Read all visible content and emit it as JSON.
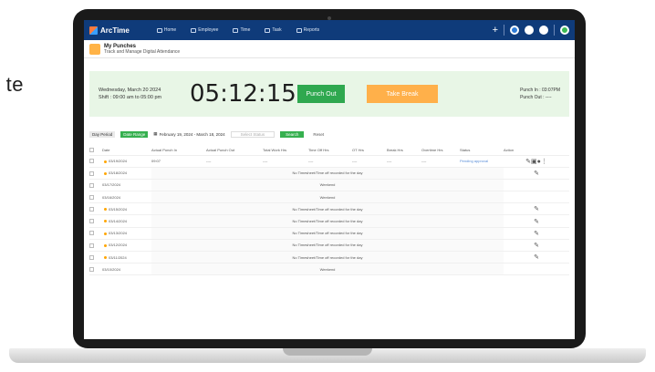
{
  "side_text": "te",
  "app": {
    "name": "ArcTime"
  },
  "nav": [
    "Home",
    "Employee",
    "Time",
    "Task",
    "Reports"
  ],
  "subheader": {
    "title": "My Punches",
    "subtitle": "Track and Manage Digital Attendance"
  },
  "punch": {
    "date": "Wednesday, March 20 2024",
    "shift": "Shift : 09:00 am to 05:00 pm",
    "clock": "05:12:15",
    "punch_out_label": "Punch Out",
    "take_break_label": "Take Break",
    "punch_in_info": "Punch In : 03:07PM",
    "punch_out_info": "Punch Out : ----"
  },
  "filters": {
    "day_period": "Day Period",
    "date_range_tag": "Date Range",
    "date_range": "February 19, 2024 - March 18, 2024",
    "status": "Select Status",
    "search": "Search",
    "reset": "Reset"
  },
  "table": {
    "headers": [
      "Date",
      "Actual Punch In",
      "Actual Punch Out",
      "Total Work Hrs",
      "Time Off Hrs",
      "OT Hrs",
      "Break Hrs",
      "Overtime Hrs",
      "Status",
      "Action"
    ],
    "first_row": {
      "date": "03/19/2024",
      "punch_in": "09:07",
      "dash": "----",
      "status": "Pending approval"
    },
    "rows": [
      {
        "date": "03/18/2024",
        "msg": "No Timesheet/Time off recorded for the day",
        "edit": true
      },
      {
        "date": "03/17/2024",
        "msg": "Weekend",
        "edit": false
      },
      {
        "date": "03/16/2024",
        "msg": "Weekend",
        "edit": false
      },
      {
        "date": "03/15/2024",
        "msg": "No Timesheet/Time off recorded for the day",
        "edit": true
      },
      {
        "date": "03/14/2024",
        "msg": "No Timesheet/Time off recorded for the day",
        "edit": true
      },
      {
        "date": "03/13/2024",
        "msg": "No Timesheet/Time off recorded for the day",
        "edit": true
      },
      {
        "date": "03/12/2024",
        "msg": "No Timesheet/Time off recorded for the day",
        "edit": true
      },
      {
        "date": "03/11/2024",
        "msg": "No Timesheet/Time off recorded for the day",
        "edit": true
      },
      {
        "date": "03/10/2024",
        "msg": "Weekend",
        "edit": false
      }
    ]
  },
  "icons": {
    "edit": "edit-icon"
  }
}
